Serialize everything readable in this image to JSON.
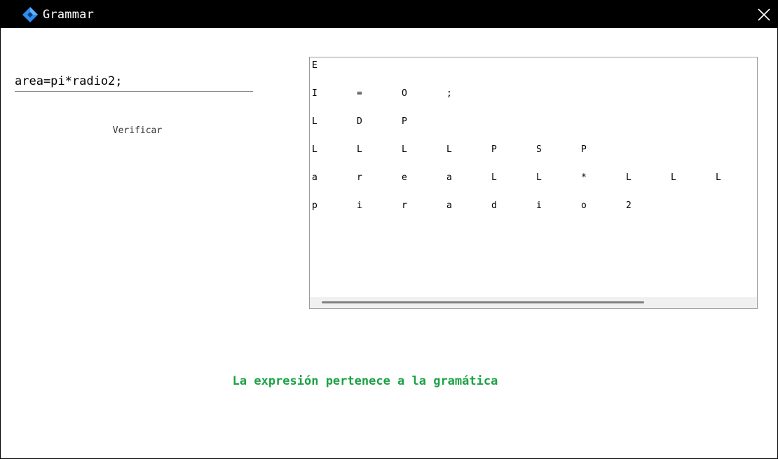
{
  "window": {
    "title": "Grammar",
    "close_icon": "close-icon",
    "app_icon": "diamond-icon"
  },
  "input": {
    "value": "area=pi*radio2;",
    "placeholder": ""
  },
  "verify_button": {
    "label": "Verificar"
  },
  "tree": {
    "rows": [
      [
        "E"
      ],
      [
        "I",
        "=",
        "O",
        ";"
      ],
      [
        "L",
        "D",
        "P"
      ],
      [
        "L",
        "L",
        "L",
        "L",
        "P",
        "S",
        "P"
      ],
      [
        "a",
        "r",
        "e",
        "a",
        "L",
        "L",
        "*",
        "L",
        "L",
        "L"
      ],
      [
        "p",
        "i",
        "r",
        "a",
        "d",
        "i",
        "o",
        "2"
      ]
    ]
  },
  "result": {
    "message": "La expresión pertenece a la gramática",
    "color": "#1ba244"
  },
  "colors": {
    "titlebar": "#000000",
    "accent": "#2d8cf0"
  }
}
